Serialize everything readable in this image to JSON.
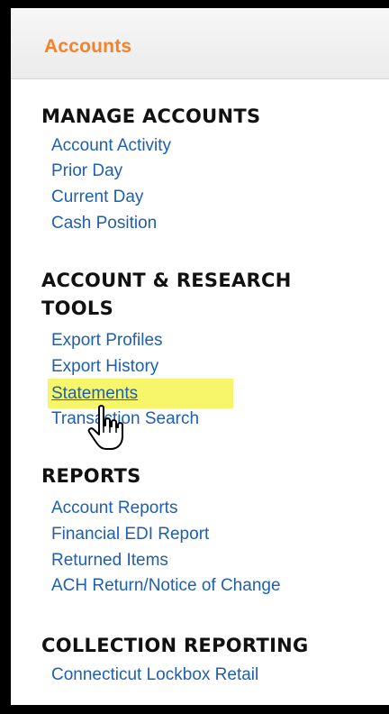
{
  "header": {
    "title": "Accounts"
  },
  "sections": {
    "manage_accounts": {
      "heading": "MANAGE ACCOUNTS",
      "links": [
        "Account Activity",
        "Prior Day",
        "Current Day",
        "Cash Position"
      ]
    },
    "research_tools": {
      "heading_line1": "ACCOUNT & RESEARCH",
      "heading_line2": "TOOLS",
      "links": [
        "Export Profiles",
        "Export History",
        "Statements",
        "Transaction Search"
      ]
    },
    "reports": {
      "heading": "REPORTS",
      "links": [
        "Account Reports",
        "Financial EDI Report",
        "Returned Items",
        "ACH Return/Notice of Change"
      ]
    },
    "collection_reporting": {
      "heading": "COLLECTION REPORTING",
      "links": [
        "Connecticut Lockbox Retail"
      ]
    }
  },
  "colors": {
    "accent": "#f5822a",
    "link": "#1f5fae",
    "highlight": "#f7f66a"
  },
  "icons": {
    "cursor": "hand-pointer-icon"
  }
}
